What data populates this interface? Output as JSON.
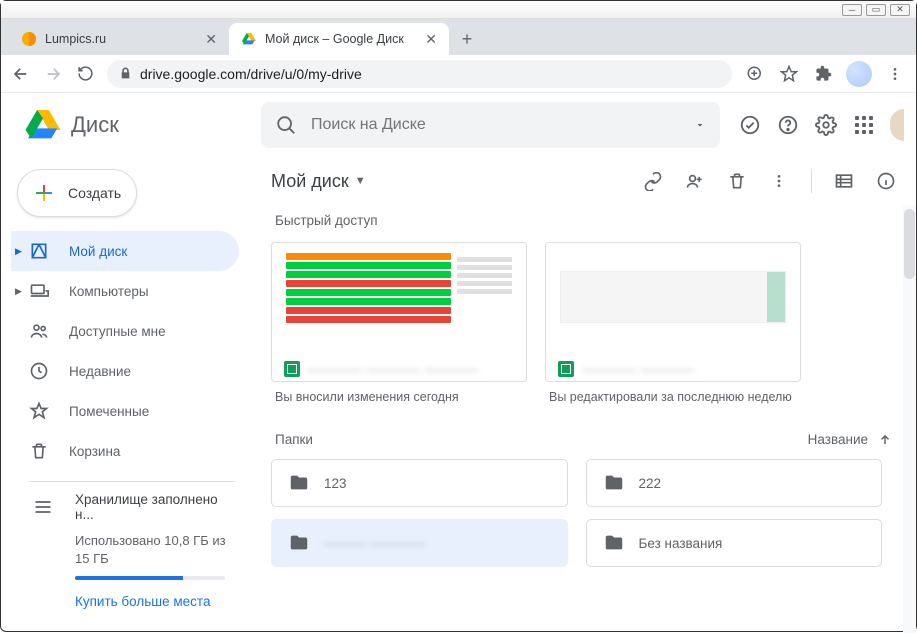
{
  "window": {
    "min": "—",
    "max": "▢",
    "close": "✕"
  },
  "tabs": [
    {
      "title": "Lumpics.ru",
      "active": false
    },
    {
      "title": "Мой диск – Google Диск",
      "active": true
    }
  ],
  "address": {
    "url": "drive.google.com/drive/u/0/my-drive"
  },
  "drive": {
    "product": "Диск",
    "search_placeholder": "Поиск на Диске",
    "create_label": "Создать",
    "nav": {
      "mydrive": "Мой диск",
      "computers": "Компьютеры",
      "shared": "Доступные мне",
      "recent": "Недавние",
      "starred": "Помеченные",
      "trash": "Корзина"
    },
    "storage": {
      "header": "Хранилище заполнено н...",
      "used_text": "Использовано 10,8 ГБ из 15 ГБ",
      "percent": 72,
      "buy": "Купить больше места"
    },
    "breadcrumb": "Мой диск",
    "quick_title": "Быстрый доступ",
    "quick": [
      {
        "name": "———— ———— ————",
        "subtitle": "Вы вносили изменения сегодня"
      },
      {
        "name": "———— ————",
        "subtitle": "Вы редактировали за последнюю неделю"
      }
    ],
    "folders_label": "Папки",
    "sort_label": "Название",
    "folders": [
      {
        "name": "123",
        "selected": false
      },
      {
        "name": "222",
        "selected": false
      },
      {
        "name": "——— ————",
        "selected": true,
        "blur": true
      },
      {
        "name": "Без названия",
        "selected": false
      }
    ]
  }
}
